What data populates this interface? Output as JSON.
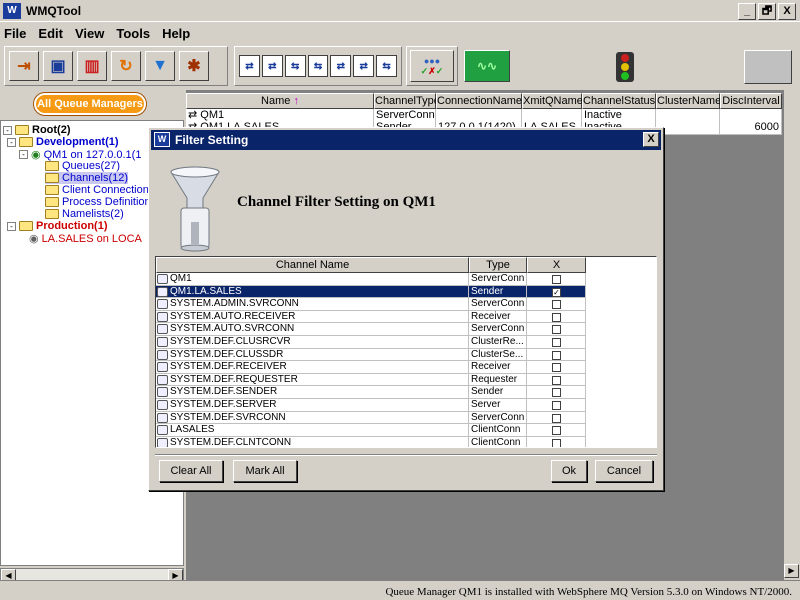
{
  "window": {
    "title": "WMQTool",
    "logo": "W",
    "minimize": "_",
    "restore": "🗗",
    "close": "X"
  },
  "menu": [
    "File",
    "Edit",
    "View",
    "Tools",
    "Help"
  ],
  "toolbar": {
    "icons": [
      "exit-icon",
      "save-icon",
      "chart-icon",
      "refresh-icon",
      "filter-icon",
      "settings-icon"
    ],
    "channel_icons": [
      "channel-start-icon",
      "channel-stop-icon",
      "channel-reset-icon",
      "channel-resolve-icon",
      "channel-ping-icon",
      "channel-status-icon",
      "channel-clear-icon"
    ]
  },
  "left_panel": {
    "all_qm_button": "All Queue Managers",
    "tree": [
      {
        "label": "Root(2)",
        "color": "#000000",
        "bold": true
      },
      {
        "label": "Development(1)",
        "color": "#0000cc",
        "bold": true
      },
      {
        "label": "QM1 on 127.0.0.1(1",
        "color": "#0000cc",
        "bold": false
      },
      {
        "label": "Queues(27)",
        "color": "#0000cc",
        "bold": false
      },
      {
        "label": "Channels(12)",
        "color": "#0000cc",
        "bold": false
      },
      {
        "label": "Client Connections",
        "color": "#0000cc",
        "bold": false
      },
      {
        "label": "Process Definitions",
        "color": "#0000cc",
        "bold": false
      },
      {
        "label": "Namelists(2)",
        "color": "#0000cc",
        "bold": false
      },
      {
        "label": "Production(1)",
        "color": "#cc0000",
        "bold": true
      },
      {
        "label": "LA.SALES on LOCA",
        "color": "#cc0000",
        "bold": false
      }
    ]
  },
  "channel_grid": {
    "columns": [
      "Name",
      "ChannelType",
      "ConnectionName",
      "XmitQName",
      "ChannelStatus",
      "ClusterName",
      "DiscInterval"
    ],
    "sort_arrow": "↑",
    "rows": [
      [
        "QM1",
        "ServerConn",
        "",
        "",
        "Inactive",
        "",
        ""
      ],
      [
        "QM1.LA.SALES",
        "Sender",
        "127.0.0.1(1420)",
        "LA.SALES",
        "Inactive",
        "",
        "6000"
      ]
    ]
  },
  "dialog": {
    "title": "Filter Setting",
    "logo": "W",
    "close": "X",
    "heading": "Channel Filter Setting on QM1",
    "columns": [
      "Channel Name",
      "Type",
      "X"
    ],
    "rows": [
      {
        "name": "QM1",
        "type": "ServerConn",
        "checked": false,
        "selected": false
      },
      {
        "name": "QM1.LA.SALES",
        "type": "Sender",
        "checked": true,
        "selected": true
      },
      {
        "name": "SYSTEM.ADMIN.SVRCONN",
        "type": "ServerConn",
        "checked": false,
        "selected": false
      },
      {
        "name": "SYSTEM.AUTO.RECEIVER",
        "type": "Receiver",
        "checked": false,
        "selected": false
      },
      {
        "name": "SYSTEM.AUTO.SVRCONN",
        "type": "ServerConn",
        "checked": false,
        "selected": false
      },
      {
        "name": "SYSTEM.DEF.CLUSRCVR",
        "type": "ClusterRe...",
        "checked": false,
        "selected": false
      },
      {
        "name": "SYSTEM.DEF.CLUSSDR",
        "type": "ClusterSe...",
        "checked": false,
        "selected": false
      },
      {
        "name": "SYSTEM.DEF.RECEIVER",
        "type": "Receiver",
        "checked": false,
        "selected": false
      },
      {
        "name": "SYSTEM.DEF.REQUESTER",
        "type": "Requester",
        "checked": false,
        "selected": false
      },
      {
        "name": "SYSTEM.DEF.SENDER",
        "type": "Sender",
        "checked": false,
        "selected": false
      },
      {
        "name": "SYSTEM.DEF.SERVER",
        "type": "Server",
        "checked": false,
        "selected": false
      },
      {
        "name": "SYSTEM.DEF.SVRCONN",
        "type": "ServerConn",
        "checked": false,
        "selected": false
      },
      {
        "name": "LASALES",
        "type": "ClientConn",
        "checked": false,
        "selected": false
      },
      {
        "name": "SYSTEM.DEF.CLNTCONN",
        "type": "ClientConn",
        "checked": false,
        "selected": false
      }
    ],
    "buttons": {
      "clear_all": "Clear All",
      "mark_all": "Mark All",
      "ok": "Ok",
      "cancel": "Cancel"
    }
  },
  "status_bar": "Queue Manager QM1 is installed with WebSphere MQ Version 5.3.0 on Windows NT/2000."
}
